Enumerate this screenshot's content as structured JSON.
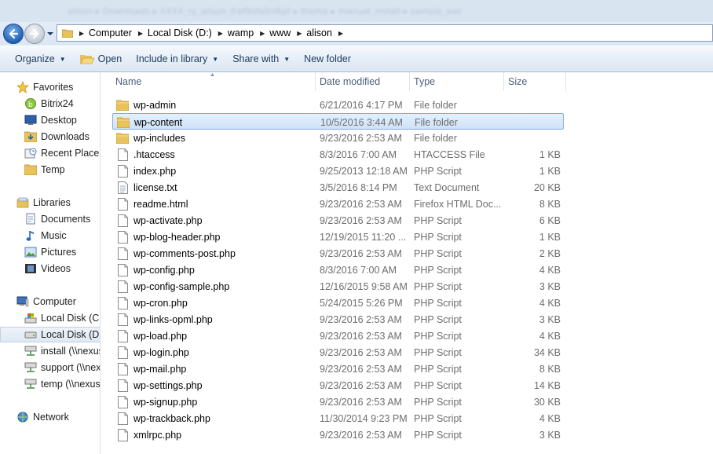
{
  "window": {
    "blurred_title_path": "alison  ▸  Downloads  ▸  XXXX_ry_alison_fraf9sfa0n9gll  ▸  theme  ▸  manual_install  ▸  sample_exe"
  },
  "address_bar": {
    "crumbs": [
      "Computer",
      "Local Disk (D:)",
      "wamp",
      "www",
      "alison"
    ]
  },
  "toolbar": {
    "organize": "Organize",
    "open": "Open",
    "include_in_library": "Include in library",
    "share_with": "Share with",
    "new_folder": "New folder"
  },
  "nav": {
    "favorites": {
      "label": "Favorites",
      "items": [
        "Bitrix24",
        "Desktop",
        "Downloads",
        "Recent Places",
        "Temp"
      ]
    },
    "libraries": {
      "label": "Libraries",
      "items": [
        "Documents",
        "Music",
        "Pictures",
        "Videos"
      ]
    },
    "computer": {
      "label": "Computer",
      "items": [
        "Local Disk (C:)",
        "Local Disk (D:)",
        "install (\\\\nexus",
        "support (\\\\nex",
        "temp (\\\\nexus"
      ]
    },
    "network": {
      "label": "Network"
    }
  },
  "columns": {
    "name": "Name",
    "date": "Date modified",
    "type": "Type",
    "size": "Size"
  },
  "files": [
    {
      "name": "wp-admin",
      "date": "6/21/2016 4:17 PM",
      "type": "File folder",
      "size": "",
      "icon": "folder"
    },
    {
      "name": "wp-content",
      "date": "10/5/2016 3:44 AM",
      "type": "File folder",
      "size": "",
      "icon": "folder",
      "selected": true
    },
    {
      "name": "wp-includes",
      "date": "9/23/2016 2:53 AM",
      "type": "File folder",
      "size": "",
      "icon": "folder"
    },
    {
      "name": ".htaccess",
      "date": "8/3/2016 7:00 AM",
      "type": "HTACCESS File",
      "size": "1 KB",
      "icon": "file"
    },
    {
      "name": "index.php",
      "date": "9/25/2013 12:18 AM",
      "type": "PHP Script",
      "size": "1 KB",
      "icon": "file"
    },
    {
      "name": "license.txt",
      "date": "3/5/2016 8:14 PM",
      "type": "Text Document",
      "size": "20 KB",
      "icon": "text"
    },
    {
      "name": "readme.html",
      "date": "9/23/2016 2:53 AM",
      "type": "Firefox HTML Doc...",
      "size": "8 KB",
      "icon": "file"
    },
    {
      "name": "wp-activate.php",
      "date": "9/23/2016 2:53 AM",
      "type": "PHP Script",
      "size": "6 KB",
      "icon": "file"
    },
    {
      "name": "wp-blog-header.php",
      "date": "12/19/2015 11:20 ...",
      "type": "PHP Script",
      "size": "1 KB",
      "icon": "file"
    },
    {
      "name": "wp-comments-post.php",
      "date": "9/23/2016 2:53 AM",
      "type": "PHP Script",
      "size": "2 KB",
      "icon": "file"
    },
    {
      "name": "wp-config.php",
      "date": "8/3/2016 7:00 AM",
      "type": "PHP Script",
      "size": "4 KB",
      "icon": "file"
    },
    {
      "name": "wp-config-sample.php",
      "date": "12/16/2015 9:58 AM",
      "type": "PHP Script",
      "size": "3 KB",
      "icon": "file"
    },
    {
      "name": "wp-cron.php",
      "date": "5/24/2015 5:26 PM",
      "type": "PHP Script",
      "size": "4 KB",
      "icon": "file"
    },
    {
      "name": "wp-links-opml.php",
      "date": "9/23/2016 2:53 AM",
      "type": "PHP Script",
      "size": "3 KB",
      "icon": "file"
    },
    {
      "name": "wp-load.php",
      "date": "9/23/2016 2:53 AM",
      "type": "PHP Script",
      "size": "4 KB",
      "icon": "file"
    },
    {
      "name": "wp-login.php",
      "date": "9/23/2016 2:53 AM",
      "type": "PHP Script",
      "size": "34 KB",
      "icon": "file"
    },
    {
      "name": "wp-mail.php",
      "date": "9/23/2016 2:53 AM",
      "type": "PHP Script",
      "size": "8 KB",
      "icon": "file"
    },
    {
      "name": "wp-settings.php",
      "date": "9/23/2016 2:53 AM",
      "type": "PHP Script",
      "size": "14 KB",
      "icon": "file"
    },
    {
      "name": "wp-signup.php",
      "date": "9/23/2016 2:53 AM",
      "type": "PHP Script",
      "size": "30 KB",
      "icon": "file"
    },
    {
      "name": "wp-trackback.php",
      "date": "11/30/2014 9:23 PM",
      "type": "PHP Script",
      "size": "4 KB",
      "icon": "file"
    },
    {
      "name": "xmlrpc.php",
      "date": "9/23/2016 2:53 AM",
      "type": "PHP Script",
      "size": "3 KB",
      "icon": "file"
    }
  ]
}
